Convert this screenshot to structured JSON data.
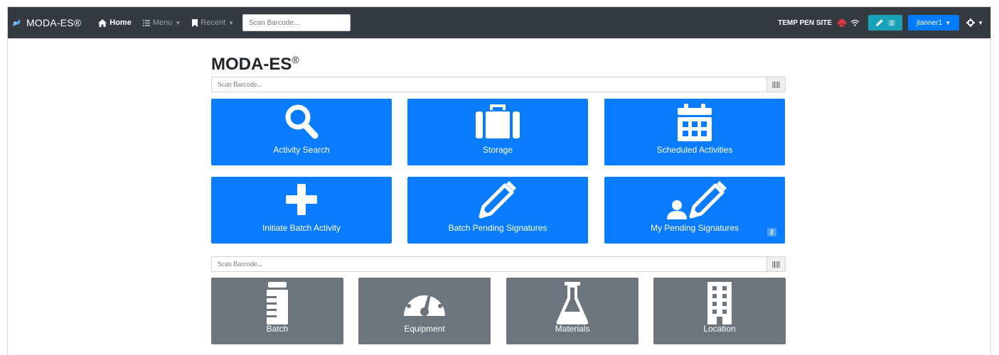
{
  "navbar": {
    "brand": "MODA-ES®",
    "home_label": "Home",
    "menu_label": "Menu",
    "recent_label": "Recent",
    "search_placeholder": "Scan Barcode...",
    "site_name": "TEMP PEN SITE",
    "pen_count": "2",
    "user_label": "jtanner1",
    "colors": {
      "bg": "#343a40",
      "pen_button": "#17a2b8",
      "user_button": "#007bff",
      "alert": "#dc3545"
    }
  },
  "page": {
    "title": "MODA-ES",
    "title_mark": "®"
  },
  "scan_top": {
    "placeholder": "Scan Barcode..."
  },
  "scan_bottom": {
    "placeholder": "Scan Barcode..."
  },
  "activities": [
    {
      "label": "Activity Search",
      "icon": "search-icon"
    },
    {
      "label": "Storage",
      "icon": "suitcase-icon"
    },
    {
      "label": "Scheduled Activities",
      "icon": "calendar-icon"
    },
    {
      "label": "Initiate Batch Activity",
      "icon": "plus-icon"
    },
    {
      "label": "Batch Pending Signatures",
      "icon": "pencil-icon"
    },
    {
      "label": "My Pending Signatures",
      "icon": "user-pencil-icon",
      "badge": "2"
    }
  ],
  "objects": [
    {
      "label": "Batch",
      "icon": "jar-icon"
    },
    {
      "label": "Equipment",
      "icon": "gauge-icon"
    },
    {
      "label": "Materials",
      "icon": "flask-icon"
    },
    {
      "label": "Location",
      "icon": "building-icon"
    }
  ],
  "colors": {
    "tile_blue": "#0a7cff",
    "tile_gray": "#6c757d"
  }
}
